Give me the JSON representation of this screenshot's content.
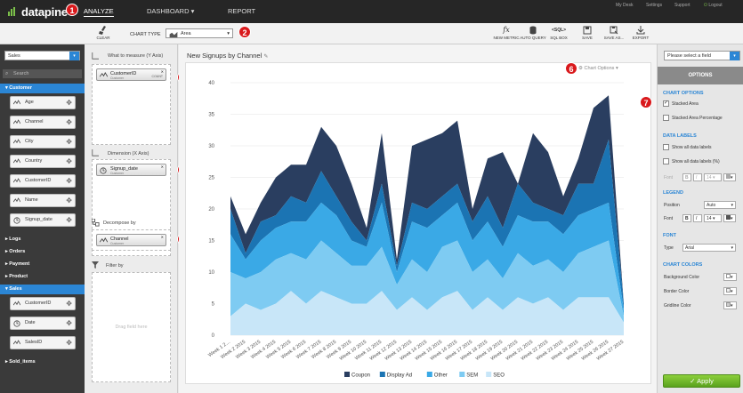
{
  "header": {
    "logo_text": "datapine",
    "nav": [
      "ANALYZE",
      "DASHBOARD",
      "REPORT"
    ],
    "right_links": [
      "My Desk",
      "Settings",
      "Support",
      "Logout"
    ]
  },
  "toolbar": {
    "clear_label": "CLEAR",
    "chart_type_label": "CHART TYPE",
    "chart_type_value": "Area",
    "buttons": [
      "NEW METRIC",
      "AUTO QUERY",
      "SQL BOX",
      "SAVE",
      "SAVE AS...",
      "EXPORT"
    ],
    "sql_glyph": "<SQL>"
  },
  "sidebar": {
    "source_select": "Sales",
    "search_placeholder": "Search",
    "groups": [
      {
        "label": "Customer",
        "expanded": true,
        "fields": [
          "Age",
          "Channel",
          "City",
          "Country",
          "CustomerID",
          "Name",
          "Signup_date"
        ]
      },
      {
        "label": "Logs",
        "expanded": false,
        "fields": []
      },
      {
        "label": "Orders",
        "expanded": false,
        "fields": []
      },
      {
        "label": "Payment",
        "expanded": false,
        "fields": []
      },
      {
        "label": "Product",
        "expanded": false,
        "fields": []
      },
      {
        "label": "Sales",
        "expanded": true,
        "fields": [
          "CustomerID",
          "Date",
          "SalesID"
        ]
      },
      {
        "label": "Sold_items",
        "expanded": false,
        "fields": []
      }
    ]
  },
  "builder": {
    "measure_title": "What to measure (Y Axis)",
    "measure_chip": "CustomerID",
    "measure_sub": "Customer",
    "measure_agg": "COUNT",
    "dimension_title": "Dimension (X Axis)",
    "dimension_chip": "Signup_date",
    "dimension_sub": "Customer",
    "decompose_title": "Decompose by",
    "decompose_chip": "Channel",
    "decompose_sub": "Customer",
    "filter_title": "Filter by",
    "filter_placeholder": "Drag field here"
  },
  "badges": [
    "1",
    "2",
    "3",
    "4",
    "5",
    "6",
    "7"
  ],
  "chart_panel": {
    "title": "New Signups by Channel",
    "options_label": "Chart Options"
  },
  "chart_data": {
    "type": "area",
    "stacked": true,
    "title": "New Signups by Channel",
    "ylim": [
      0,
      40
    ],
    "yticks": [
      0,
      5,
      10,
      15,
      20,
      25,
      30,
      35,
      40
    ],
    "categories": [
      "Week 1 2…",
      "Week 2 2015",
      "Week 3 2015",
      "Week 4 2015",
      "Week 5 2015",
      "Week 6 2015",
      "Week 7 2015",
      "Week 8 2015",
      "Week 9 2015",
      "Week 10 2015",
      "Week 11 2015",
      "Week 12 2015",
      "Week 13 2015",
      "Week 14 2015",
      "Week 15 2015",
      "Week 16 2015",
      "Week 17 2015",
      "Week 18 2015",
      "Week 19 2015",
      "Week 20 2015",
      "Week 21 2015",
      "Week 22 2015",
      "Week 23 2015",
      "Week 24 2015",
      "Week 25 2015",
      "Week 26 2015",
      "Week 27 2015"
    ],
    "series": [
      {
        "name": "SEO",
        "color": "#c8e6f8",
        "values": [
          3,
          5,
          4,
          5,
          7,
          5,
          7,
          6,
          5,
          5,
          7,
          4,
          6,
          4,
          6,
          7,
          4,
          6,
          4,
          6,
          5,
          6,
          4,
          6,
          6,
          6,
          2
        ]
      },
      {
        "name": "SEM",
        "color": "#7ecbf2",
        "values": [
          7,
          4,
          6,
          7,
          6,
          7,
          8,
          7,
          6,
          6,
          7,
          4,
          6,
          6,
          8,
          8,
          6,
          6,
          5,
          7,
          6,
          6,
          6,
          7,
          8,
          9,
          1
        ]
      },
      {
        "name": "Other",
        "color": "#3aa9e6",
        "values": [
          6,
          3,
          5,
          5,
          5,
          6,
          6,
          6,
          4,
          3,
          7,
          2,
          6,
          7,
          5,
          6,
          5,
          6,
          5,
          6,
          7,
          6,
          6,
          6,
          6,
          6,
          1
        ]
      },
      {
        "name": "Display Ad",
        "color": "#1b74b3",
        "values": [
          4,
          1,
          3,
          2,
          4,
          3,
          5,
          3,
          3,
          1,
          3,
          1,
          3,
          3,
          3,
          3,
          3,
          4,
          3,
          5,
          3,
          2,
          3,
          5,
          4,
          10,
          1
        ]
      },
      {
        "name": "Coupon",
        "color": "#2a3e60",
        "values": [
          2,
          3,
          3,
          6,
          5,
          6,
          7,
          8,
          6,
          2,
          8,
          1,
          9,
          11,
          10,
          10,
          2,
          6,
          12,
          0,
          11,
          9,
          3,
          4,
          12,
          7,
          0
        ]
      }
    ],
    "legend_position": "bottom",
    "grid": true
  },
  "options_panel": {
    "field_select": "Please select a field",
    "header": "OPTIONS",
    "chart_options_title": "CHART OPTIONS",
    "stacked_area": "Stacked Area",
    "stacked_area_pct": "Stacked Area Percentage",
    "data_labels_title": "DATA LABELS",
    "show_all": "Show all data labels",
    "show_all_pct": "Show all data labels (%)",
    "font_label": "Font",
    "bold": "B",
    "italic": "I",
    "size": "14",
    "legend_title": "LEGEND",
    "position_label": "Position",
    "position_value": "Auto",
    "font_title": "FONT",
    "type_label": "Type",
    "type_value": "Arial",
    "chart_colors_title": "CHART COLORS",
    "bg_color": "Background Color",
    "border_color": "Border Color",
    "gridline_color": "Gridline Color",
    "apply": "Apply"
  }
}
